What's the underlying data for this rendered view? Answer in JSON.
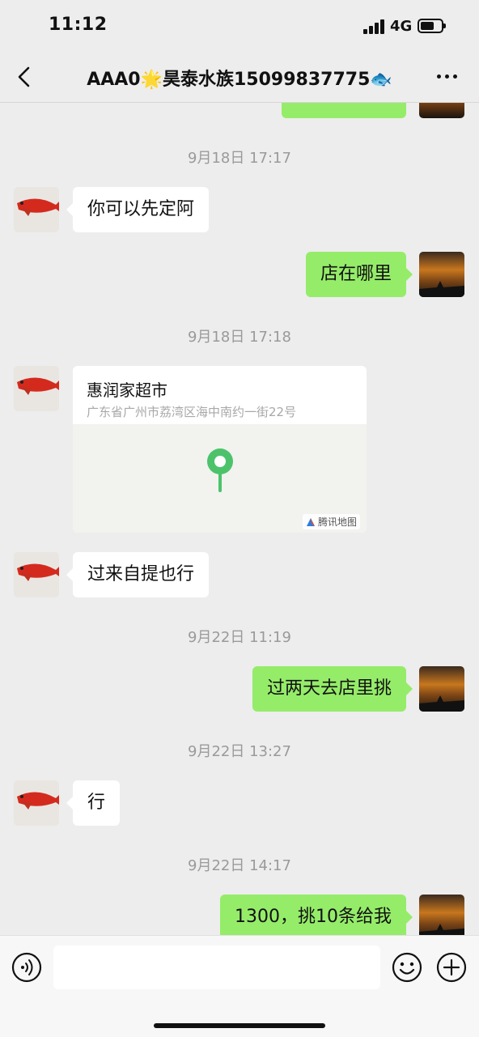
{
  "status_bar": {
    "time": "11:12",
    "network": "4G"
  },
  "header": {
    "title": "AAA0🌟昊泰水族15099837775🐟"
  },
  "messages": [
    {
      "type": "timestamp",
      "text": "9月18日 17:17"
    },
    {
      "type": "text",
      "side": "in",
      "text": "你可以先定阿"
    },
    {
      "type": "text",
      "side": "out",
      "text": "店在哪里"
    },
    {
      "type": "timestamp",
      "text": "9月18日 17:18"
    },
    {
      "type": "location",
      "side": "in",
      "name": "惠润家超市",
      "address": "广东省广州市荔湾区海中南约一街22号",
      "map_brand": "腾讯地图"
    },
    {
      "type": "text",
      "side": "in",
      "text": "过来自提也行"
    },
    {
      "type": "timestamp",
      "text": "9月22日 11:19"
    },
    {
      "type": "text",
      "side": "out",
      "text": "过两天去店里挑"
    },
    {
      "type": "timestamp",
      "text": "9月22日 13:27"
    },
    {
      "type": "text",
      "side": "in",
      "text": "行"
    },
    {
      "type": "timestamp",
      "text": "9月22日 14:17"
    },
    {
      "type": "text",
      "side": "out",
      "text": "1300，挑10条给我"
    }
  ],
  "input": {
    "value": "",
    "placeholder": ""
  },
  "colors": {
    "out_bubble": "#95ec69",
    "in_bubble": "#ffffff",
    "background": "#ededed",
    "pin": "#4cc36b"
  }
}
